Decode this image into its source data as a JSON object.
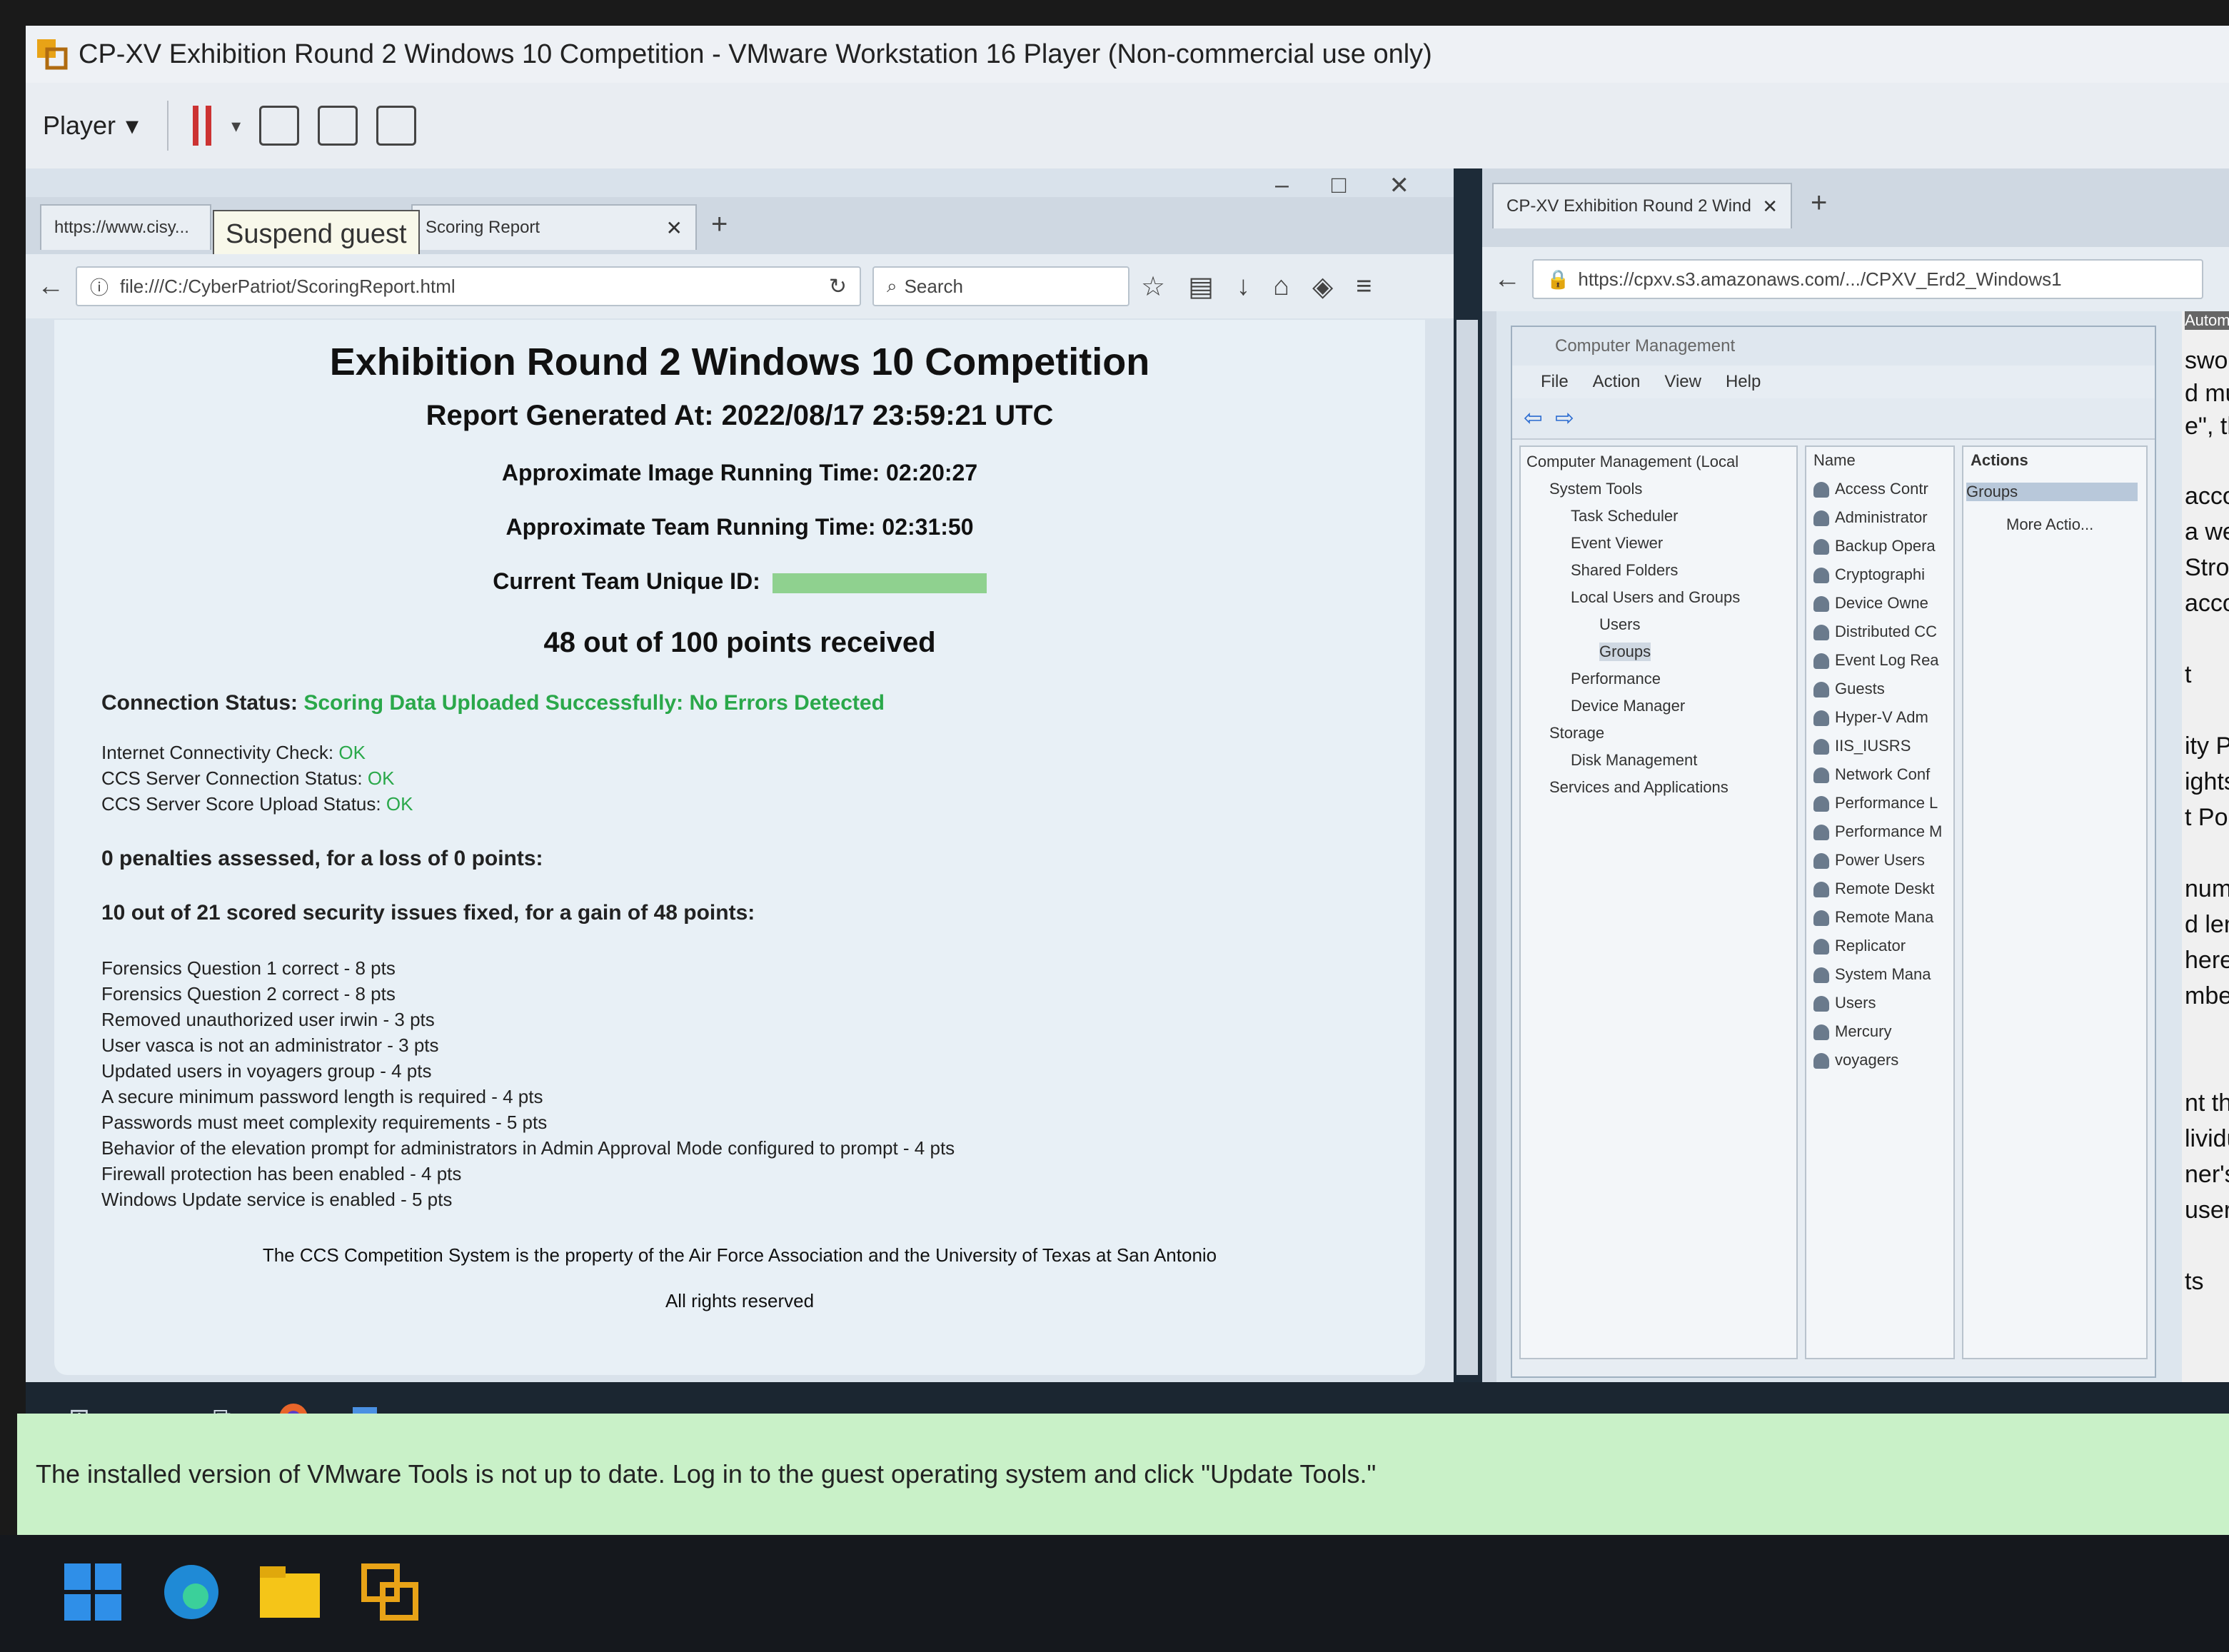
{
  "vmware": {
    "title": "CP-XV Exhibition Round 2 Windows 10 Competition - VMware Workstation 16 Player (Non-commercial use only)",
    "player_label": "Player",
    "tooltip": "Suspend guest"
  },
  "firefox_left": {
    "tab1_label": "https://www.cisy...",
    "tab2_label": "Scoring Report",
    "url": "file:///C:/CyberPatriot/ScoringReport.html",
    "search_placeholder": "Search"
  },
  "report": {
    "title": "Exhibition Round 2 Windows 10 Competition",
    "generated": "Report Generated At: 2022/08/17 23:59:21 UTC",
    "image_time": "Approximate Image Running Time: 02:20:27",
    "team_time": "Approximate Team Running Time: 02:31:50",
    "team_id_label": "Current Team Unique ID:",
    "points": "48 out of 100 points received",
    "conn_label": "Connection Status:",
    "conn_value": "Scoring Data Uploaded Successfully: No Errors Detected",
    "checks": [
      {
        "label": "Internet Connectivity Check:",
        "value": "OK"
      },
      {
        "label": "CCS Server Connection Status:",
        "value": "OK"
      },
      {
        "label": "CCS Server Score Upload Status:",
        "value": "OK"
      }
    ],
    "penalties": "0 penalties assessed, for a loss of 0 points:",
    "issues": "10 out of 21 scored security issues fixed, for a gain of 48 points:",
    "items": [
      "Forensics Question 1 correct - 8 pts",
      "Forensics Question 2 correct - 8 pts",
      "Removed unauthorized user irwin - 3 pts",
      "User vasca is not an administrator - 3 pts",
      "Updated users in voyagers group - 4 pts",
      "A secure minimum password length is required - 4 pts",
      "Passwords must meet complexity requirements - 5 pts",
      "Behavior of the elevation prompt for administrators in Admin Approval Mode configured to prompt - 4 pts",
      "Firewall protection has been enabled - 4 pts",
      "Windows Update service is enabled - 5 pts"
    ],
    "footer1": "The CCS Competition System is the property of the Air Force Association and the University of Texas at San Antonio",
    "footer2": "All rights reserved"
  },
  "firefox_right": {
    "tab_label": "CP-XV Exhibition Round 2 Wind",
    "url": "https://cpxv.s3.amazonaws.com/.../CPXV_Erd2_Windows1"
  },
  "comp_mgmt": {
    "title": "Computer Management",
    "menu": [
      "File",
      "Action",
      "View",
      "Help"
    ],
    "tree": [
      "Computer Management (Local",
      "System Tools",
      "Task Scheduler",
      "Event Viewer",
      "Shared Folders",
      "Local Users and Groups",
      "Users",
      "Groups",
      "Performance",
      "Device Manager",
      "Storage",
      "Disk Management",
      "Services and Applications"
    ],
    "name_header": "Name",
    "groups": [
      "Access Contr",
      "Administrator",
      "Backup Opera",
      "Cryptographi",
      "Device Owne",
      "Distributed CC",
      "Event Log Rea",
      "Guests",
      "Hyper-V Adm",
      "IIS_IUSRS",
      "Network Conf",
      "Performance L",
      "Performance M",
      "Power Users",
      "Remote Deskt",
      "Remote Mana",
      "Replicator",
      "System Mana",
      "Users",
      "Mercury",
      "voyagers"
    ],
    "actions_header": "Actions",
    "actions_selected": "Groups",
    "more_actions": "More Actio..."
  },
  "side_text": [
    "sword m",
    "d must",
    "e\", then",
    "accoun",
    "a weak",
    "Strong",
    "accoun",
    "t",
    "ity Polic",
    "ights As",
    "t Polici",
    "num pa",
    "d length",
    "here you",
    "mber is",
    "nt that",
    "lividuals",
    "ner's file",
    "user of",
    "ts"
  ],
  "side_header": "Automatic",
  "notification": "The installed version of VMware Tools is not up to date. Log in to the guest operating system and click \"Update Tools.\""
}
